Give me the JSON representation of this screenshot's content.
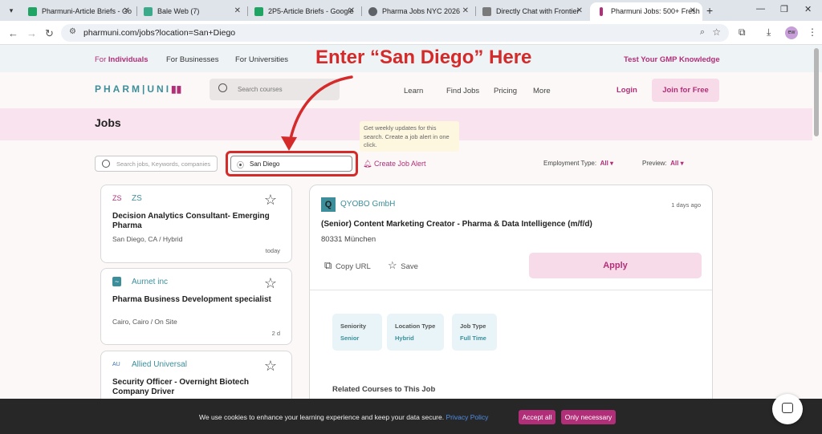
{
  "browser": {
    "tabs": [
      {
        "title": "Pharmuni-Article Briefs - Go",
        "favicon_color": "#1fa463"
      },
      {
        "title": "Bale Web (7)",
        "favicon_color": "#3aaa8a"
      },
      {
        "title": "2P5-Article Briefs - Google",
        "favicon_color": "#1fa463"
      },
      {
        "title": "Pharma Jobs NYC 2026",
        "favicon_color": "#5f6368"
      },
      {
        "title": "Directly Chat with Frontier",
        "favicon_color": "#7a7a7a"
      },
      {
        "title": "Pharmuni Jobs: 500+ Fresh",
        "favicon_color": "#b12f78"
      }
    ],
    "url": "pharmuni.com/jobs?location=San+Diego",
    "profile_initials": "ew"
  },
  "topbar": {
    "individuals_prefix": "For ",
    "individuals_bold": "Individuals",
    "businesses": "For Businesses",
    "universities": "For Universities",
    "gmp_link": "Test Your GMP Knowledge"
  },
  "header": {
    "logo_left": "PHARM",
    "logo_divider": "|",
    "logo_right": "UNI",
    "search_placeholder": "Search courses",
    "nav": [
      "Learn",
      "Find Jobs",
      "Pricing",
      "More"
    ],
    "login": "Login",
    "join": "Join for Free"
  },
  "page_title": "Jobs",
  "annotation": "Enter “San Diego” Here",
  "tooltip": "Get weekly updates for this search. Create a job alert in one click.",
  "filters": {
    "keyword_placeholder": "Search jobs, Keywords, companies",
    "location_value": "San Diego",
    "create_alert": "Create Job Alert",
    "employment_label": "Employment Type:",
    "employment_value": "All",
    "preview_label": "Preview:",
    "preview_value": "All"
  },
  "jobs": [
    {
      "logo": "ZS",
      "company": "ZS",
      "title": "Decision Analytics Consultant- Emerging Pharma",
      "location": "San Diego, CA / Hybrid",
      "age": "today"
    },
    {
      "logo": "~",
      "company": "Aurnet inc",
      "title": "Pharma Business Development specialist",
      "location": "Cairo, Cairo / On Site",
      "age": "2 d"
    },
    {
      "logo": "AU",
      "company": "Allied Universal",
      "title": "Security Officer - Overnight Biotech Company Driver",
      "location": "",
      "age": ""
    }
  ],
  "detail": {
    "logo_letter": "Q",
    "company": "QYOBO GmbH",
    "posted": "1 days ago",
    "title": "(Senior) Content Marketing Creator - Pharma & Data Intelligence (m/f/d)",
    "city": "80331 München",
    "copy_url": "Copy URL",
    "save": "Save",
    "apply": "Apply",
    "tags": [
      {
        "key": "Seniority",
        "value": "Senior"
      },
      {
        "key": "Location Type",
        "value": "Hybrid"
      },
      {
        "key": "Job Type",
        "value": "Full Time"
      }
    ],
    "related": "Related Courses to This Job"
  },
  "cookie": {
    "message": "We use cookies to enhance your learning experience and keep your data secure.",
    "policy": "Privacy Policy",
    "accept": "Accept all",
    "necessary": "Only necessary"
  },
  "colors": {
    "brand": "#b12f78",
    "teal": "#3c8f9a",
    "annotation": "#d42a2a"
  }
}
